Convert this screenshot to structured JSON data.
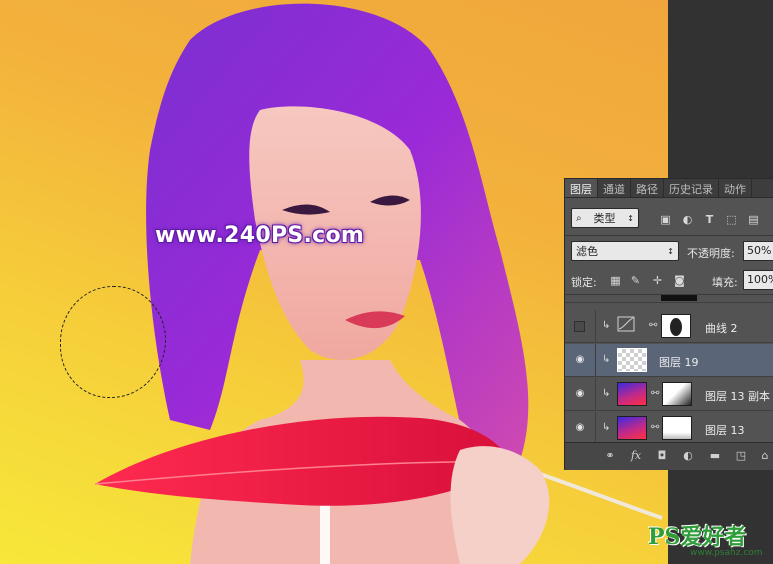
{
  "document": {
    "watermark": "www.240PS.com"
  },
  "layers_panel": {
    "tabs": [
      "图层",
      "通道",
      "路径",
      "历史记录",
      "动作"
    ],
    "active_tab": 0,
    "filter_kind": "类型",
    "blend_mode": "滤色",
    "opacity_label": "不透明度:",
    "opacity_value": "50%",
    "lock_label": "锁定:",
    "fill_label": "填充:",
    "fill_value": "100%",
    "layers": [
      {
        "name": "曲线 2",
        "visible": false,
        "clipped": true,
        "type": "curves-adjustment",
        "selected": false
      },
      {
        "name": "图层 19",
        "visible": true,
        "clipped": true,
        "type": "transparent",
        "selected": true
      },
      {
        "name": "图层 13 副本",
        "visible": true,
        "clipped": true,
        "type": "gradient-with-mask",
        "selected": false
      },
      {
        "name": "图层 13",
        "visible": true,
        "clipped": true,
        "type": "gradient-with-mask",
        "selected": false
      }
    ],
    "footer_icons": [
      "link-icon",
      "fx-icon",
      "mask-icon",
      "adjustment-icon",
      "folder-icon",
      "new-layer-icon",
      "trash-icon"
    ]
  },
  "logo": {
    "main": "PS爱好者",
    "sub": "www.psahz.com"
  },
  "colors": {
    "selection_highlight": "#5a6678",
    "panel_bg": "#535353",
    "logo_green": "#2f9e3a"
  }
}
